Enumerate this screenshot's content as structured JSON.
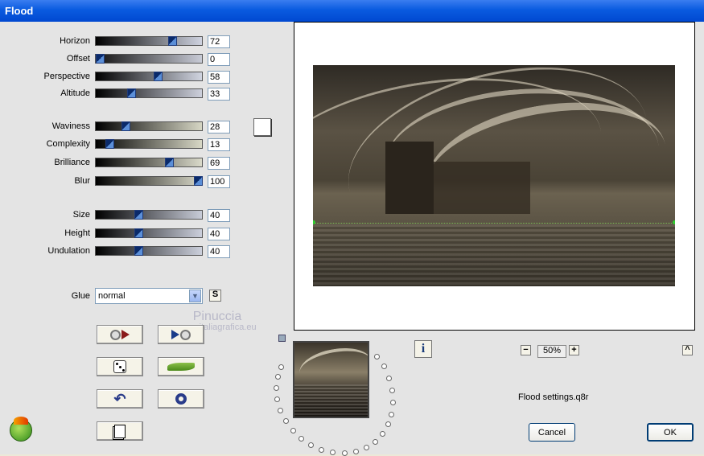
{
  "window": {
    "title": "Flood"
  },
  "sliders": [
    {
      "label": "Horizon",
      "value": "72",
      "pct": 0.72
    },
    {
      "label": "Offset",
      "value": "0",
      "pct": 0.0
    },
    {
      "label": "Perspective",
      "value": "58",
      "pct": 0.58
    },
    {
      "label": "Altitude",
      "value": "33",
      "pct": 0.33
    },
    {
      "label": "Waviness",
      "value": "28",
      "pct": 0.28
    },
    {
      "label": "Complexity",
      "value": "13",
      "pct": 0.13
    },
    {
      "label": "Brilliance",
      "value": "69",
      "pct": 0.69
    },
    {
      "label": "Blur",
      "value": "100",
      "pct": 1.0
    },
    {
      "label": "Size",
      "value": "40",
      "pct": 0.4
    },
    {
      "label": "Height",
      "value": "40",
      "pct": 0.4
    },
    {
      "label": "Undulation",
      "value": "40",
      "pct": 0.4
    }
  ],
  "glue": {
    "label": "Glue",
    "value": "normal",
    "s_label": "S"
  },
  "watermark": {
    "name": "Pinuccia",
    "url": "www.italiagrafica.eu"
  },
  "zoom": {
    "minus": "−",
    "value": "50%",
    "plus": "+"
  },
  "settings_file": "Flood settings.q8r",
  "buttons": {
    "cancel": "Cancel",
    "ok": "OK",
    "collapse": "^"
  },
  "icons": {
    "randomize_back": "disc-play-back-icon",
    "randomize_forward": "play-disc-icon",
    "dice": "dice-icon",
    "wave": "wave-icon",
    "undo": "undo-icon",
    "reset": "ring-icon",
    "copy": "page-copy-icon",
    "info": "info-icon",
    "logo": "app-logo-icon"
  },
  "colors": {
    "title_blue": "#0a5be0",
    "background": "#e4e4e4"
  }
}
